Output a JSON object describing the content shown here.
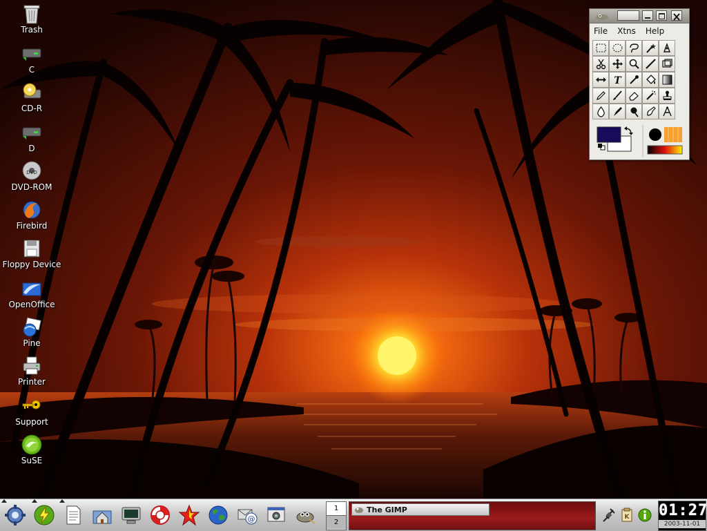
{
  "desktop": {
    "icons": [
      {
        "label": "Trash",
        "icon": "trash-icon"
      },
      {
        "label": "C",
        "icon": "hard-drive-icon"
      },
      {
        "label": "CD-R",
        "icon": "cd-r-icon"
      },
      {
        "label": "D",
        "icon": "hard-drive-icon"
      },
      {
        "label": "DVD-ROM",
        "icon": "dvd-icon"
      },
      {
        "label": "Firebird",
        "icon": "firebird-icon"
      },
      {
        "label": "Floppy Device",
        "icon": "floppy-icon"
      },
      {
        "label": "OpenOffice",
        "icon": "openoffice-icon"
      },
      {
        "label": "Pine",
        "icon": "pine-mail-icon"
      },
      {
        "label": "Printer",
        "icon": "printer-icon"
      },
      {
        "label": "Support",
        "icon": "key-icon"
      },
      {
        "label": "SuSE",
        "icon": "suse-icon"
      }
    ]
  },
  "gimp": {
    "menu": [
      "File",
      "Xtns",
      "Help"
    ],
    "foreground_color": "#1a0a5a",
    "background_color": "#ffffff",
    "brush": "circle",
    "pattern": "orange"
  },
  "taskbar": {
    "quick_launch": [
      "kde-menu-icon",
      "suse-lightning-icon",
      "text-editor-icon",
      "home-folder-icon",
      "terminal-icon",
      "help-lifebuoy-icon",
      "star-icon",
      "browser-globe-icon",
      "email-icon",
      "screenshot-icon",
      "gimp-icon"
    ],
    "pager": [
      "1",
      "2"
    ],
    "tasks": [
      {
        "label": "The GIMP"
      }
    ],
    "clock": {
      "time": "01:27",
      "date": "2003-11-01"
    }
  }
}
